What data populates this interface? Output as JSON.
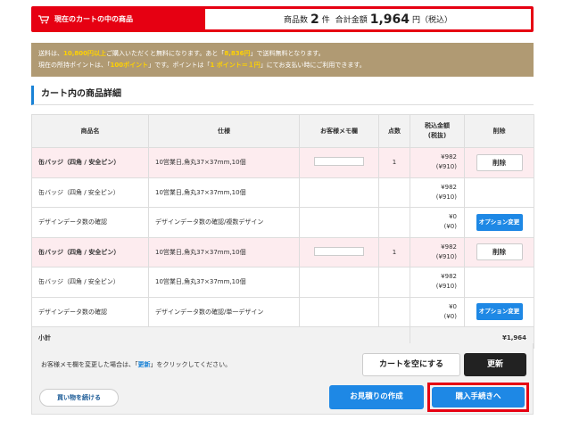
{
  "cart_bar": {
    "title": "現在のカートの中の商品",
    "count_label": "商品数",
    "count_value": "2",
    "count_unit": "件",
    "total_label": "合計金額",
    "total_value": "1,964",
    "total_unit": "円（税込）"
  },
  "notice": {
    "line1_a": "送料は、",
    "line1_b": "10,800円以上",
    "line1_c": "ご購入いただくと無料になります。あと「",
    "line1_d": "8,836円",
    "line1_e": "」で送料無料となります。",
    "line2_a": "現在の所持ポイントは、「",
    "line2_b": "100ポイント",
    "line2_c": "」です。ポイントは「",
    "line2_d": "1 ポイント＝１円",
    "line2_e": "」にてお支払い時にご利用できます。"
  },
  "section_title": "カート内の商品詳細",
  "columns": {
    "name": "商品名",
    "spec": "仕様",
    "memo": "お客様メモ欄",
    "qty": "点数",
    "price_1": "税込金額",
    "price_2": "(税抜)",
    "del": "削除"
  },
  "rows": [
    {
      "name": "缶バッジ（四角 / 安全ピン）",
      "spec": "10営業日,角丸37×37mm,10個",
      "qty": "1",
      "price": "¥982",
      "price_ex": "(¥910)",
      "action": "削除"
    },
    {
      "name": "缶バッジ（四角 / 安全ピン）",
      "spec": "10営業日,角丸37×37mm,10個",
      "qty": "",
      "price": "¥982",
      "price_ex": "(¥910)",
      "action": ""
    },
    {
      "name": "デザインデータ数の確認",
      "spec": "デザインデータ数の確認/複数デザイン",
      "qty": "",
      "price": "¥0",
      "price_ex": "(¥0)",
      "action": "オプション変更"
    },
    {
      "name": "缶バッジ（四角 / 安全ピン）",
      "spec": "10営業日,角丸37×37mm,10個",
      "qty": "1",
      "price": "¥982",
      "price_ex": "(¥910)",
      "action": "削除"
    },
    {
      "name": "缶バッジ（四角 / 安全ピン）",
      "spec": "10営業日,角丸37×37mm,10個",
      "qty": "",
      "price": "¥982",
      "price_ex": "(¥910)",
      "action": ""
    },
    {
      "name": "デザインデータ数の確認",
      "spec": "デザインデータ数の確認/単一デザイン",
      "qty": "",
      "price": "¥0",
      "price_ex": "(¥0)",
      "action": "オプション変更"
    }
  ],
  "subtotal": {
    "label": "小計",
    "value": "¥1,964"
  },
  "memo_note": {
    "a": "お客様メモ欄を変更した場合は、「",
    "b": "更新",
    "c": "」をクリックしてください。"
  },
  "buttons": {
    "clear": "カートを空にする",
    "update": "更新",
    "continue": "買い物を続ける",
    "estimate": "お見積りの作成",
    "checkout": "購入手続きへ"
  },
  "colors": {
    "accent_red": "#e60012",
    "accent_blue": "#1e88e5",
    "notice_bg": "#b09a73",
    "highlight_yellow": "#ffd200"
  }
}
